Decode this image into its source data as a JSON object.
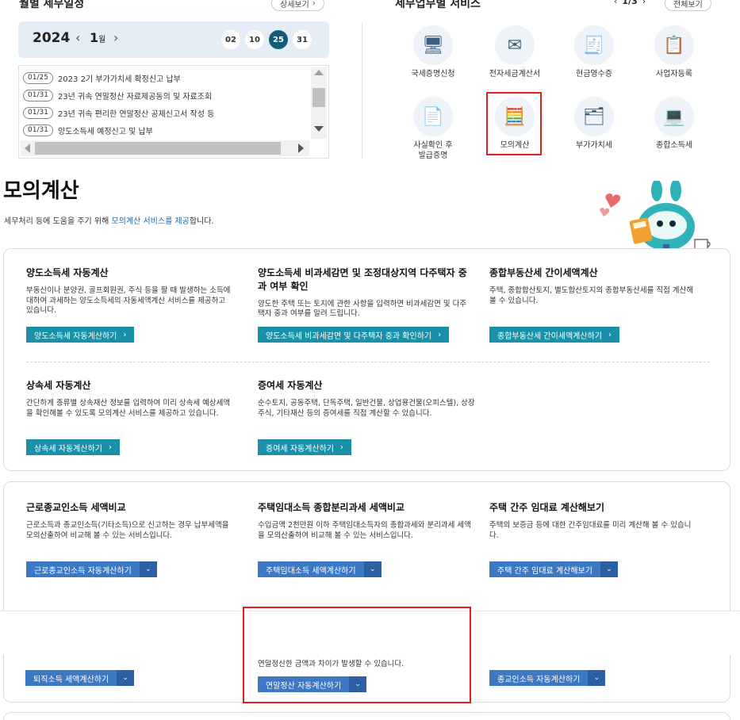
{
  "top": {
    "schedule_title": "월별 세무일정",
    "schedule_more": "상세보기",
    "services_title": "세무업무별 서비스",
    "services_page": "1/3",
    "services_all": "전체보기"
  },
  "calendar": {
    "year": "2024",
    "month": "1",
    "month_unit": "월",
    "days": [
      "02",
      "10",
      "25",
      "31"
    ],
    "active_day": "25"
  },
  "schedule": [
    {
      "date": "01/25",
      "text": "2023 2기 부가가치세 확정신고 납부"
    },
    {
      "date": "01/31",
      "text": "23년 귀속 연말정산 자료제공동의 및 자료조회"
    },
    {
      "date": "01/31",
      "text": "23년 귀속 편리한 연말정산 공제신고서 작성 등"
    },
    {
      "date": "01/31",
      "text": "양도소득세 예정신고 및 납부"
    }
  ],
  "services": [
    {
      "label": "국세증명신청",
      "icon": "certificate-icon"
    },
    {
      "label": "전자세금계산서",
      "icon": "e-invoice-icon"
    },
    {
      "label": "현금영수증",
      "icon": "receipt-icon"
    },
    {
      "label": "사업자등록",
      "icon": "business-registration-icon"
    },
    {
      "label": "사실확인 후\n발급증명",
      "icon": "fact-check-icon"
    },
    {
      "label": "모의계산",
      "icon": "calculator-icon"
    },
    {
      "label": "부가가치세",
      "icon": "vat-icon"
    },
    {
      "label": "종합소득세",
      "icon": "income-tax-icon"
    }
  ],
  "page": {
    "title": "모의계산",
    "desc_pre": "세무처리 등에 도움을 주기 위해 ",
    "desc_link": "모의계산 서비스를 제공",
    "desc_post": "합니다."
  },
  "panel1": [
    {
      "title": "양도소득세 자동계산",
      "desc": "부동산이나 분양권, 골프회원권, 주식 등을 팔 때 발생하는 소득에 대하여 과세하는 양도소득세의 자동세액계산 서비스를 제공하고 있습니다.",
      "button": "양도소득세 자동계산하기"
    },
    {
      "title": "양도소득세 비과세감면 및 조정대상지역 다주택자 중과 여부 확인",
      "desc": "양도한 주택 또는 토지에 관한 사항을 입력하면 비과세감면 및 다주택자 중과 여부를 알려 드립니다.",
      "button": "양도소득세 비과세감면 및 다주택자 중과 확인하기"
    },
    {
      "title": "종합부동산세 간이세액계산",
      "desc": "주택, 종합합산토지, 별도합산토지의 종합부동산세를 직접 계산해 볼 수 있습니다.",
      "button": "종합부동산세 간이세액계산하기"
    },
    {
      "title": "상속세 자동계산",
      "desc": "간단하게 종류별 상속재산 정보를 입력하여 미리 상속세 예상세액을 확인해볼 수 있도록 모의계산 서비스를 제공하고 있습니다.",
      "button": "상속세 자동계산하기"
    },
    {
      "title": "증여세 자동계산",
      "desc": "순수토지, 공동주택, 단독주택, 일반건물, 상업용건물(오피스텔), 상장주식, 기타재산 등의 증여세를 직접 계산할 수 있습니다.",
      "button": "증여세 자동계산하기"
    }
  ],
  "panel2": [
    {
      "title": "근로종교인소득 세액비교",
      "desc": "근로소득과 종교인소득(기타소득)으로 신고하는 경우 납부세액을 모의산출하여 비교해 볼 수 있는 서비스입니다.",
      "button": "근로종교인소득 자동계산하기"
    },
    {
      "title": "주택임대소득 종합분리과세 세액비교",
      "desc": "수입금액 2천만원 이하 주택임대소득자의 종합과세와 분리과세 세액을 모의산출하여 비교해 볼 수 있는 서비스입니다.",
      "button": "주택임대소득 세액계산하기"
    },
    {
      "title": "주택 간주 임대료 계산해보기",
      "desc": "주택의 보증금 등에 대한 간주임대료를 미리 계산해 볼 수 있습니다.",
      "button": "주택 간주 임대료 계산해보기"
    }
  ],
  "panel3": [
    {
      "button": "퇴직소득 세액계산하기"
    },
    {
      "desc": "연말정산한 금액과 차이가 발생할 수 있습니다.",
      "button": "연말정산 자동계산하기"
    },
    {
      "button": "종교인소득 자동계산하기"
    }
  ],
  "colors": {
    "accent_teal": "#1b91a9",
    "accent_blue": "#3d78c4",
    "highlight_red": "#e02020",
    "calendar_active": "#0f5d78"
  }
}
